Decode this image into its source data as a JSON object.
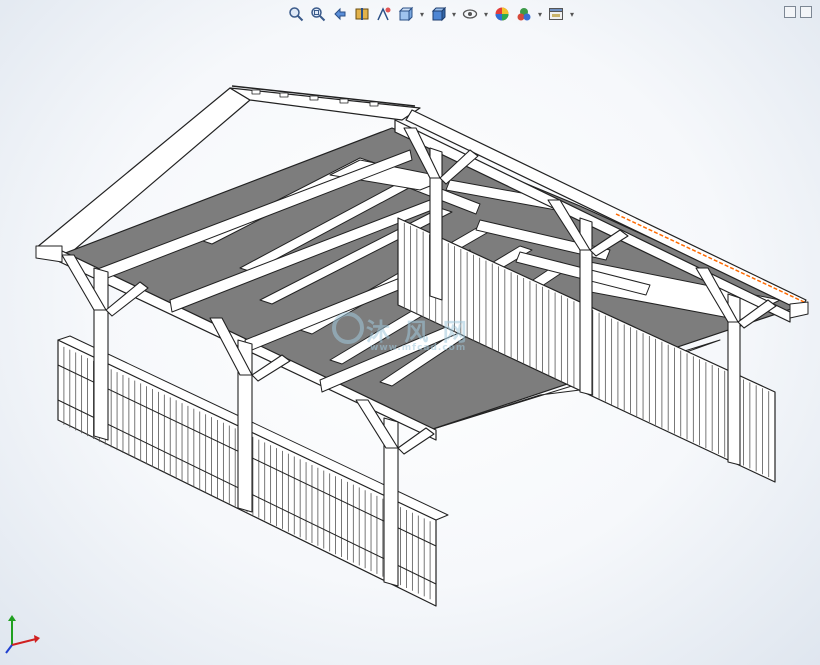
{
  "app": {
    "name": "SolidWorks 3D viewport"
  },
  "toolbar": {
    "tools": [
      {
        "icon": "zoom-to-fit-icon"
      },
      {
        "icon": "zoom-to-area-icon"
      },
      {
        "icon": "previous-view-icon"
      },
      {
        "icon": "section-view-icon"
      },
      {
        "icon": "dynamic-annotation-icon"
      },
      {
        "icon": "view-orientation-icon"
      },
      {
        "icon": "display-style-icon"
      },
      {
        "icon": "hide-show-items-icon"
      },
      {
        "icon": "edit-appearance-icon"
      },
      {
        "icon": "apply-scene-icon"
      },
      {
        "icon": "view-settings-icon"
      }
    ]
  },
  "watermark": {
    "main": "沐 风 网",
    "sub": "www.mfcad.com"
  },
  "triad": {
    "x_color": "#d02020",
    "y_color": "#20a020",
    "z_color": "#2040d0"
  },
  "colors": {
    "roof": "#7d7d7d",
    "frame": "#ffffff",
    "edge": "#222222",
    "accent_edge": "#ff6a00"
  }
}
